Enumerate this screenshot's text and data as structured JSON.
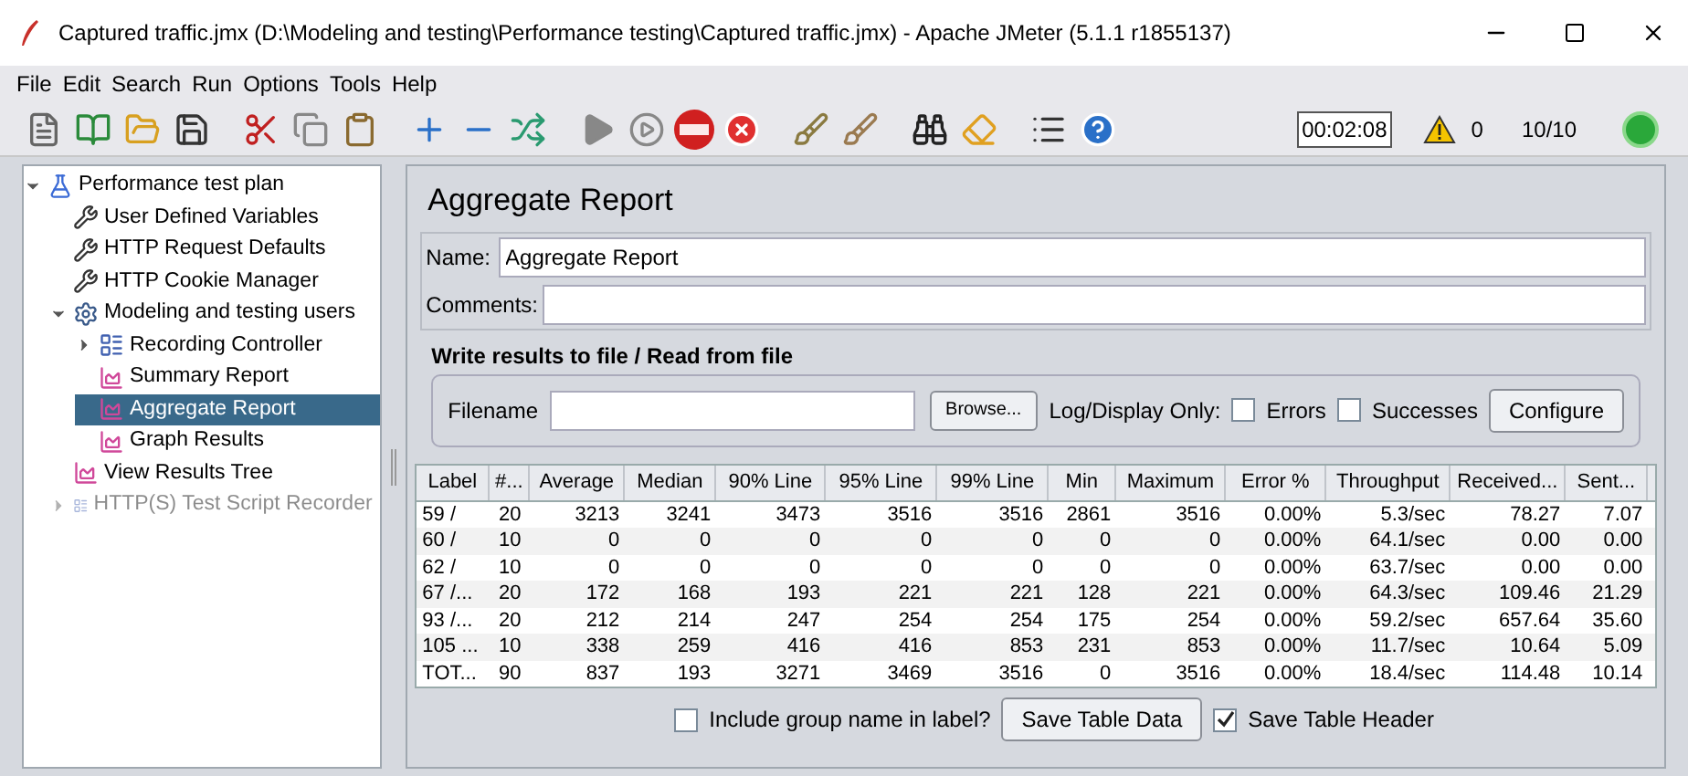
{
  "window": {
    "title": "Captured traffic.jmx (D:\\Modeling and testing\\Performance testing\\Captured traffic.jmx) - Apache JMeter (5.1.1 r1855137)"
  },
  "menu": [
    "File",
    "Edit",
    "Search",
    "Run",
    "Options",
    "Tools",
    "Help"
  ],
  "status": {
    "timer": "00:02:08",
    "warnings": "0",
    "threads": "10/10"
  },
  "tree": [
    {
      "label": "Performance test plan",
      "kind": "plan",
      "expanded": true,
      "selected": false,
      "disabled": false,
      "children": [
        {
          "label": "User Defined Variables",
          "kind": "config",
          "selected": false,
          "disabled": false
        },
        {
          "label": "HTTP Request Defaults",
          "kind": "config",
          "selected": false,
          "disabled": false
        },
        {
          "label": "HTTP Cookie Manager",
          "kind": "config",
          "selected": false,
          "disabled": false
        },
        {
          "label": "Modeling and testing users",
          "kind": "group",
          "expanded": true,
          "selected": false,
          "disabled": false,
          "children": [
            {
              "label": "Recording Controller",
              "kind": "controller",
              "expanded": false,
              "selected": false,
              "disabled": false
            },
            {
              "label": "Summary Report",
              "kind": "listener",
              "selected": false,
              "disabled": false
            },
            {
              "label": "Aggregate Report",
              "kind": "listener",
              "selected": true,
              "disabled": false
            },
            {
              "label": "Graph Results",
              "kind": "listener",
              "selected": false,
              "disabled": false
            }
          ]
        },
        {
          "label": "View Results Tree",
          "kind": "listener",
          "selected": false,
          "disabled": false
        },
        {
          "label": "HTTP(S) Test Script Recorder",
          "kind": "controller",
          "expanded": false,
          "selected": false,
          "disabled": true
        }
      ]
    }
  ],
  "panel": {
    "title": "Aggregate Report",
    "name_label": "Name:",
    "name_value": "Aggregate Report",
    "comments_label": "Comments:",
    "file_section": {
      "title": "Write results to file / Read from file",
      "filename_label": "Filename",
      "browse": "Browse...",
      "log_label": "Log/Display Only:",
      "errors": {
        "label": "Errors",
        "checked": false
      },
      "successes": {
        "label": "Successes",
        "checked": false
      },
      "configure": "Configure"
    }
  },
  "table": {
    "columns": [
      "Label",
      "#...",
      "Average",
      "Median",
      "90% Line",
      "95% Line",
      "99% Line",
      "Min",
      "Maximum",
      "Error %",
      "Throughput",
      "Received...",
      "Sent..."
    ],
    "rows": [
      [
        "59 /",
        "20",
        "3213",
        "3241",
        "3473",
        "3516",
        "3516",
        "2861",
        "3516",
        "0.00%",
        "5.3/sec",
        "78.27",
        "7.07"
      ],
      [
        "60 /",
        "10",
        "0",
        "0",
        "0",
        "0",
        "0",
        "0",
        "0",
        "0.00%",
        "64.1/sec",
        "0.00",
        "0.00"
      ],
      [
        "62 /",
        "10",
        "0",
        "0",
        "0",
        "0",
        "0",
        "0",
        "0",
        "0.00%",
        "63.7/sec",
        "0.00",
        "0.00"
      ],
      [
        "67 /...",
        "20",
        "172",
        "168",
        "193",
        "221",
        "221",
        "128",
        "221",
        "0.00%",
        "64.3/sec",
        "109.46",
        "21.29"
      ],
      [
        "93 /...",
        "20",
        "212",
        "214",
        "247",
        "254",
        "254",
        "175",
        "254",
        "0.00%",
        "59.2/sec",
        "657.64",
        "35.60"
      ],
      [
        "105 ...",
        "10",
        "338",
        "259",
        "416",
        "416",
        "853",
        "231",
        "853",
        "0.00%",
        "11.7/sec",
        "10.64",
        "5.09"
      ],
      [
        "TOT...",
        "90",
        "837",
        "193",
        "3271",
        "3469",
        "3516",
        "0",
        "3516",
        "0.00%",
        "18.4/sec",
        "114.48",
        "10.14"
      ]
    ]
  },
  "footer": {
    "include_group": {
      "label": "Include group name in label?",
      "checked": false
    },
    "save_data": "Save Table Data",
    "save_header": {
      "label": "Save Table Header",
      "checked": true
    }
  }
}
